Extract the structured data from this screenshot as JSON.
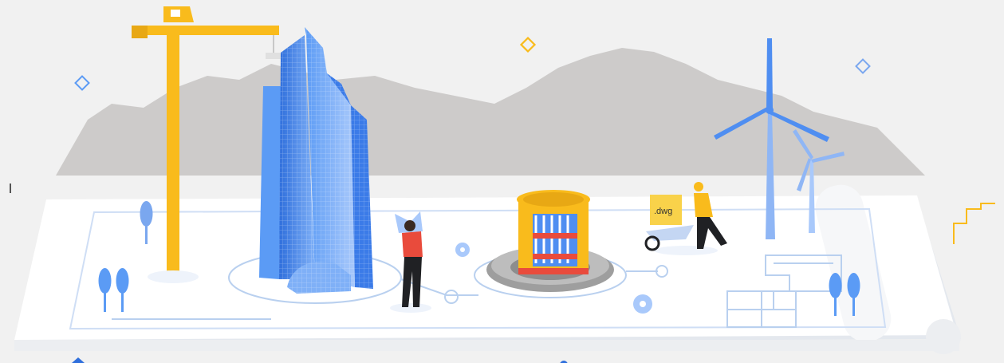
{
  "illustration": {
    "box_label": ".dwg",
    "elements": [
      "tower-crane",
      "glass-skyscraper",
      "person-with-blueprint",
      "cable-reel-machine",
      "worker-with-wheelbarrow",
      "wind-turbine",
      "gear-icon",
      "tree-icon",
      "sparkle-icon"
    ]
  },
  "colors": {
    "background": "#f1f1f1",
    "mountains": "#cdcbca",
    "sheet": "#ffffff",
    "line_blue": "#b9d0ef",
    "crane_yellow": "#f9bb1c",
    "building_blue": "#4f8ef1",
    "tree_blue": "#7aa7ef",
    "gear_gray": "#9e9e9e",
    "reel_yellow": "#f9bb1c",
    "red": "#e94b3c",
    "turbine_blue": "#8fb6f5"
  }
}
